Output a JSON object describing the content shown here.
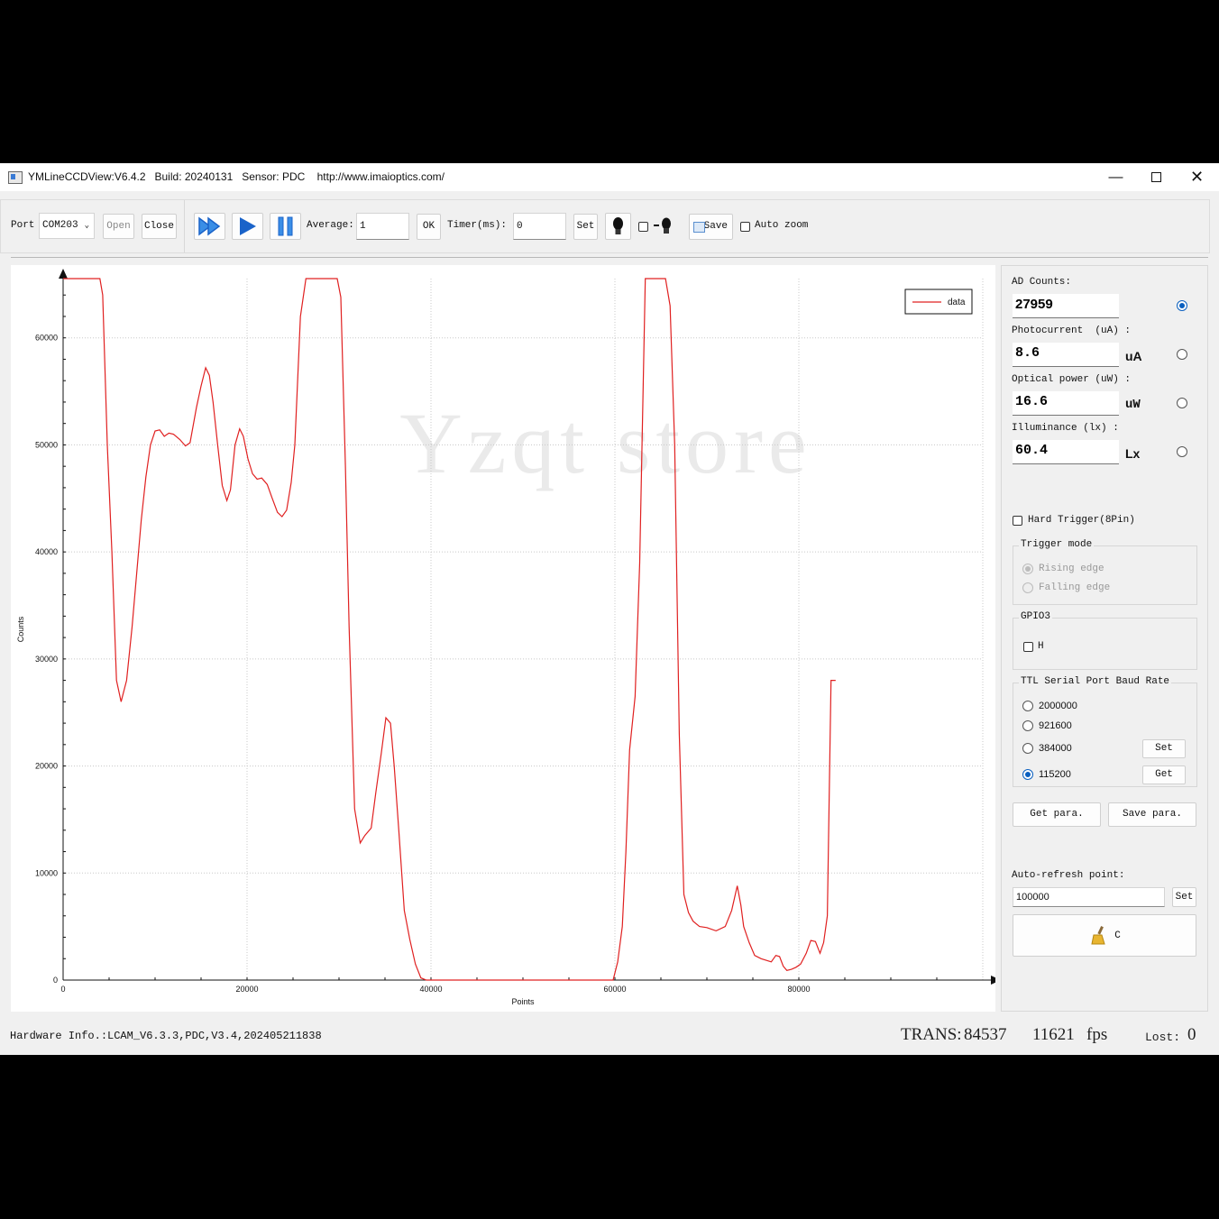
{
  "window": {
    "title": "YMLineCCDView:V6.4.2   Build: 20240131   Sensor: PDC    http://www.imaioptics.com/",
    "minimize_icon": "minimize-icon",
    "maximize_icon": "maximize-icon",
    "close_icon": "close-icon"
  },
  "toolbar": {
    "port_label": "Port",
    "port_value": "COM203",
    "open_label": "Open",
    "close_label": "Close",
    "average_label": "Average:",
    "average_value": "1",
    "ok_label": "OK",
    "timer_label": "Timer(ms):",
    "timer_value": "0",
    "set_label": "Set",
    "save_label": "Save",
    "autozoom_label": "Auto zoom",
    "icons": [
      "fast-forward-icon",
      "play-icon",
      "pause-icon",
      "bulb-icon",
      "bulb-toggle-icon",
      "save-icon"
    ],
    "accent": "#1a63c9"
  },
  "watermark": "Yzqt store",
  "chart_data": {
    "type": "line",
    "xlabel": "Points",
    "ylabel": "Counts",
    "xlim": [
      0,
      100000
    ],
    "ylim": [
      0,
      65535
    ],
    "xticks": [
      0,
      20000,
      40000,
      60000,
      80000
    ],
    "yticks": [
      0,
      10000,
      20000,
      30000,
      40000,
      50000,
      60000
    ],
    "grid": true,
    "legend": "top-right",
    "color": "#e02020",
    "series": [
      {
        "name": "data",
        "x": [
          0,
          4000,
          4300,
          4800,
          5300,
          5800,
          6300,
          6900,
          7500,
          8000,
          8500,
          9000,
          9500,
          10000,
          10500,
          11000,
          11500,
          12000,
          12700,
          13300,
          13800,
          14500,
          15000,
          15500,
          15900,
          16300,
          16800,
          17300,
          17800,
          18200,
          18700,
          19200,
          19600,
          20100,
          20600,
          21100,
          21600,
          22200,
          22700,
          23300,
          23800,
          24300,
          24800,
          25200,
          25800,
          26400,
          26800,
          29800,
          30200,
          30700,
          31100,
          31700,
          32300,
          32800,
          33500,
          34000,
          34600,
          35100,
          35600,
          36000,
          36500,
          37100,
          37700,
          38300,
          38900,
          39500,
          40000,
          59800,
          60300,
          60800,
          61200,
          61600,
          62200,
          62700,
          63300,
          63600,
          65500,
          66000,
          66500,
          67000,
          67500,
          68000,
          68500,
          69200,
          70000,
          71000,
          72000,
          72700,
          73300,
          73700,
          74000,
          74600,
          75200,
          75900,
          77000,
          77500,
          77900,
          78300,
          78700,
          79200,
          79700,
          80200,
          80800,
          81300,
          81800,
          82300,
          82700,
          83100,
          83500,
          84000
        ],
        "values": [
          65535,
          65535,
          64000,
          50000,
          40000,
          28000,
          26000,
          28000,
          33000,
          38000,
          43000,
          47000,
          50000,
          51300,
          51400,
          50800,
          51100,
          51000,
          50500,
          49900,
          50200,
          53500,
          55500,
          57200,
          56500,
          54000,
          50000,
          46200,
          44800,
          45800,
          50000,
          51500,
          50800,
          48700,
          47300,
          46800,
          46900,
          46300,
          45100,
          43700,
          43300,
          43900,
          46500,
          50000,
          62000,
          65535,
          65535,
          65535,
          63800,
          48000,
          33000,
          16000,
          12800,
          13500,
          14200,
          17500,
          21200,
          24500,
          24000,
          20000,
          14000,
          6500,
          3800,
          1500,
          200,
          0,
          0,
          0,
          1700,
          5000,
          12000,
          21500,
          26500,
          39000,
          65535,
          65535,
          65535,
          63000,
          50000,
          23000,
          8000,
          6300,
          5500,
          5000,
          4900,
          4600,
          5000,
          6500,
          8800,
          7000,
          5000,
          3500,
          2300,
          2000,
          1700,
          2300,
          2200,
          1300,
          900,
          1000,
          1200,
          1500,
          2500,
          3700,
          3600,
          2500,
          3500,
          6000,
          28000,
          28000
        ]
      }
    ]
  },
  "right_panel": {
    "ad_label": "AD Counts:",
    "ad_value": "27959",
    "photocurrent_label": "Photocurrent  (uA) :",
    "photocurrent_value": "8.6",
    "photocurrent_unit": "uA",
    "optical_label": "Optical power (uW) :",
    "optical_value": "16.6",
    "optical_unit": "uW",
    "illum_label": "Illuminance (lx) :",
    "illum_value": "60.4",
    "illum_unit": "Lx",
    "hard_trigger_label": "Hard Trigger(8Pin)",
    "trigger_mode_title": "Trigger mode",
    "rising_label": "Rising edge",
    "falling_label": "Falling edge",
    "gpio_title": "GPIO3",
    "gpio_h_label": "H",
    "baud_title": "TTL Serial Port Baud Rate",
    "baud_options": [
      "2000000",
      "921600",
      "384000",
      "115200"
    ],
    "baud_selected": "115200",
    "baud_set_label": "Set",
    "baud_get_label": "Get",
    "get_para_label": "Get para.",
    "save_para_label": "Save para.",
    "auto_refresh_label": "Auto-refresh point:",
    "auto_refresh_value": "100000",
    "auto_refresh_set": "Set",
    "clear_label": "C",
    "clear_icon": "broom-icon"
  },
  "status": {
    "hardware_info": "Hardware Info.:LCAM_V6.3.3,PDC,V3.4,202405211838",
    "trans_label": "TRANS:",
    "trans_value": "84537",
    "fps_value": "11621",
    "fps_unit": "fps",
    "lost_label": "Lost:",
    "lost_value": "0"
  }
}
